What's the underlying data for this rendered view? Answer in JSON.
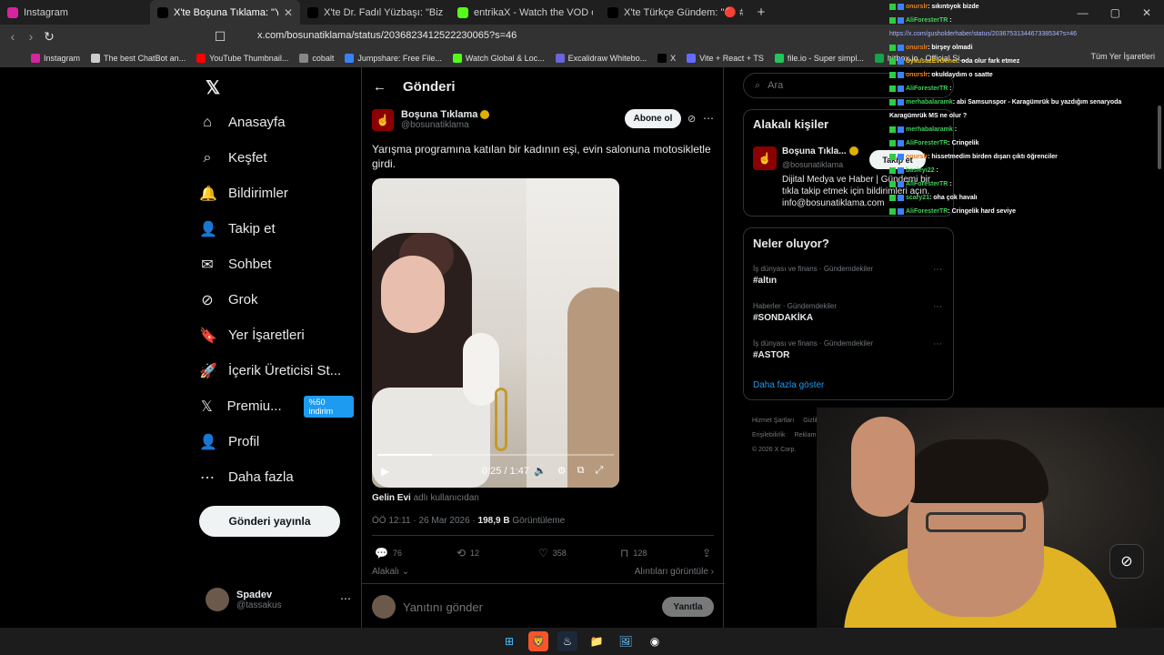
{
  "tabs": [
    {
      "title": "Instagram",
      "color": "#d6249f",
      "active": false
    },
    {
      "title": "X'te Boşuna Tıklama: \"Yarışma pr",
      "color": "#000000",
      "active": true
    },
    {
      "title": "X'te Dr. Fadıl Yüzbaşı: \"Biz Kürdistan",
      "color": "#000000",
      "active": false
    },
    {
      "title": "entrikaX - Watch the VOD on Kick",
      "color": "#53fc18",
      "active": false
    },
    {
      "title": "X'te Türkçe Gündem: \"🔴 #SONDAK",
      "color": "#000000",
      "active": false
    }
  ],
  "newtab": "+",
  "winctl": [
    "—",
    "▢",
    "✕"
  ],
  "url": "x.com/bosunatiklama/status/2036823412522230065?s=46",
  "bookmarks": [
    {
      "label": "Instagram",
      "color": "#d6249f"
    },
    {
      "label": "The best ChatBot an...",
      "color": "#cccccc"
    },
    {
      "label": "YouTube Thumbnail...",
      "color": "#ff0000"
    },
    {
      "label": "cobalt",
      "color": "#888888"
    },
    {
      "label": "Jumpshare: Free File...",
      "color": "#3b82f6"
    },
    {
      "label": "Watch Global & Loc...",
      "color": "#53fc18"
    },
    {
      "label": "Excalidraw Whitebo...",
      "color": "#6965db"
    },
    {
      "label": "X",
      "color": "#000000"
    },
    {
      "label": "Vite + React + TS",
      "color": "#646cff"
    },
    {
      "label": "file.io - Super simpl...",
      "color": "#22c55e"
    },
    {
      "label": "hitbox.io - Official Si...",
      "color": "#16a34a"
    }
  ],
  "bookmarks_all": "Tüm Yer İşaretleri",
  "nav": [
    {
      "label": "Anasayfa",
      "icon": "home-icon",
      "glyph": "⌂"
    },
    {
      "label": "Keşfet",
      "icon": "search-icon",
      "glyph": "⌕"
    },
    {
      "label": "Bildirimler",
      "icon": "bell-icon",
      "glyph": "🔔"
    },
    {
      "label": "Takip et",
      "icon": "follow-icon",
      "glyph": "👤"
    },
    {
      "label": "Sohbet",
      "icon": "mail-icon",
      "glyph": "✉"
    },
    {
      "label": "Grok",
      "icon": "grok-icon",
      "glyph": "⊘"
    },
    {
      "label": "Yer İşaretleri",
      "icon": "bookmark-icon",
      "glyph": "🔖"
    },
    {
      "label": "İçerik Üreticisi St...",
      "icon": "rocket-icon",
      "glyph": "🚀"
    },
    {
      "label": "Premiu...",
      "icon": "x-icon",
      "glyph": "𝕏"
    },
    {
      "label": "Profil",
      "icon": "profile-icon",
      "glyph": "👤"
    },
    {
      "label": "Daha fazla",
      "icon": "more-icon",
      "glyph": "⋯"
    }
  ],
  "premium_badge": "%50 indirim",
  "post_button": "Gönderi yayınla",
  "account": {
    "name": "Spadev",
    "handle": "@tassakus"
  },
  "header": {
    "title": "Gönderi"
  },
  "post": {
    "author": "Boşuna Tıklama",
    "handle": "@bosunatiklama",
    "subscribe": "Abone ol",
    "text": "Yarışma programına katılan bir kadının eşi, evin salonuna motosikletle girdi.",
    "video_time": "0:25 / 1:47",
    "video_progress": 0.23,
    "source_name": "Gelin Evi",
    "source_suffix": "adlı kullanıcıdan",
    "timestamp": "ÖÖ 12:11 · 26 Mar 2026 ·",
    "views": "198,9 B",
    "views_label": "Görüntüleme",
    "replies": "76",
    "reposts": "12",
    "likes": "358",
    "bookmarks": "128",
    "related": "Alakalı",
    "quotes": "Alıntıları görüntüle"
  },
  "reply": {
    "placeholder": "Yanıtını gönder",
    "button": "Yanıtla"
  },
  "search": {
    "placeholder": "Ara"
  },
  "related_people": {
    "title": "Alakalı kişiler",
    "name": "Boşuna Tıkla...",
    "handle": "@bosunatiklama",
    "follow": "Takip et",
    "bio": "Dijital Medya ve Haber | Gündemi bir tıkla takip etmek için bildirimleri açın. info@bosunatiklama.com"
  },
  "trends": {
    "title": "Neler oluyor?",
    "items": [
      {
        "category": "İş dünyası ve finans · Gündemdekiler",
        "tag": "#altın"
      },
      {
        "category": "Haberler · Gündemdekiler",
        "tag": "#SONDAKİKA"
      },
      {
        "category": "İş dünyası ve finans · Gündemdekiler",
        "tag": "#ASTOR"
      }
    ],
    "show_more": "Daha fazla göster"
  },
  "footer": [
    "Hizmet Şartları",
    "Gizlilik Politikası",
    "Çerez Politikası",
    "Erişilebilirlik",
    "Reklam bilgisi",
    "Daha fazla ...",
    "© 2026 X Corp."
  ],
  "chat": [
    {
      "user": "onurslr",
      "msg": ": sıkıntıyok bizde",
      "color": "#e67e22"
    },
    {
      "user": "AliForesterTR",
      "msg": " :",
      "color": "#3fd05a"
    },
    {
      "user": "",
      "msg": "https://x.com/gusholderhaber/status/2036753134467338534?s=46",
      "link": true
    },
    {
      "user": "onurslr",
      "msg": ": birşey olmadi",
      "color": "#e67e22"
    },
    {
      "user": "UykusuzEvGenci",
      "msg": ": oda olur fark etmez",
      "color": "#f1c40f"
    },
    {
      "user": "onurslr",
      "msg": ": okuldaydım o saatte",
      "color": "#e67e22"
    },
    {
      "user": "AliForesterTR",
      "msg": " :",
      "color": "#3fd05a"
    },
    {
      "user": "merhabalaramk",
      "msg": ": abi Samsunspor - Karagümrük bu yazdığım senaryoda",
      "color": "#3fd05a"
    },
    {
      "user": "",
      "msg": "Karagümrük MS ne olur ?"
    },
    {
      "user": "merhabalaramk",
      "msg": " :",
      "color": "#3fd05a"
    },
    {
      "user": "AliForesterTR",
      "msg": ": Cringelik",
      "color": "#3fd05a"
    },
    {
      "user": "onurslr",
      "msg": ": hissetmedim birden dışarı çıktı öğrenciler",
      "color": "#e67e22"
    },
    {
      "user": "basieyi22",
      "msg": " :",
      "color": "#3fd05a"
    },
    {
      "user": "AliForesterTR",
      "msg": " :",
      "color": "#3fd05a"
    },
    {
      "user": "scary21",
      "msg": ": oha çok havalı",
      "color": "#3fd05a"
    },
    {
      "user": "AliForesterTR",
      "msg": ": Cringelik hard seviye",
      "color": "#3fd05a"
    }
  ]
}
